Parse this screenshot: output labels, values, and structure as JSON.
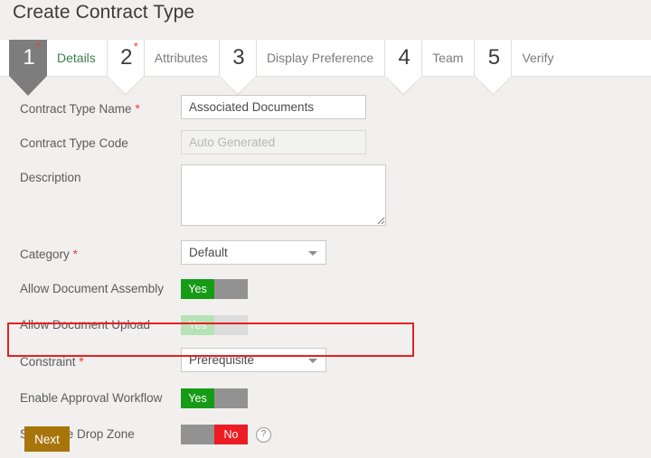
{
  "page": {
    "title": "Create Contract Type"
  },
  "stepper": {
    "steps": [
      {
        "number": "1",
        "label": "Details",
        "required": true,
        "active": true
      },
      {
        "number": "2",
        "label": "Attributes",
        "required": true,
        "active": false
      },
      {
        "number": "3",
        "label": "Display Preference",
        "required": false,
        "active": false
      },
      {
        "number": "4",
        "label": "Team",
        "required": false,
        "active": false
      },
      {
        "number": "5",
        "label": "Verify",
        "required": false,
        "active": false
      }
    ]
  },
  "form": {
    "contract_type_name": {
      "label": "Contract Type Name",
      "required_mark": "*",
      "value": "Associated Documents",
      "placeholder": ""
    },
    "contract_type_code": {
      "label": "Contract Type Code",
      "value": "",
      "placeholder": "Auto Generated"
    },
    "description": {
      "label": "Description",
      "value": "",
      "placeholder": ""
    },
    "category": {
      "label": "Category",
      "required_mark": "*",
      "selected": "Default"
    },
    "allow_document_assembly": {
      "label": "Allow Document Assembly",
      "state": "Yes"
    },
    "allow_document_upload": {
      "label": "Allow Document Upload",
      "state": "Yes"
    },
    "constraint": {
      "label": "Constraint",
      "required_mark": "*",
      "selected": "Prerequisite"
    },
    "enable_approval_workflow": {
      "label": "Enable Approval Workflow",
      "state": "Yes"
    },
    "show_file_drop_zone": {
      "label": "Show File Drop Zone",
      "state": "No",
      "help_icon": "question-mark-icon"
    }
  },
  "actions": {
    "next_label": "Next"
  },
  "colors": {
    "accent_green": "#169b16",
    "accent_red": "#ed1c24",
    "button_gold": "#a8750c",
    "highlight_red": "#e81f1f",
    "required_red": "#ee3b33",
    "step_active_grey": "#7d7d7d"
  }
}
